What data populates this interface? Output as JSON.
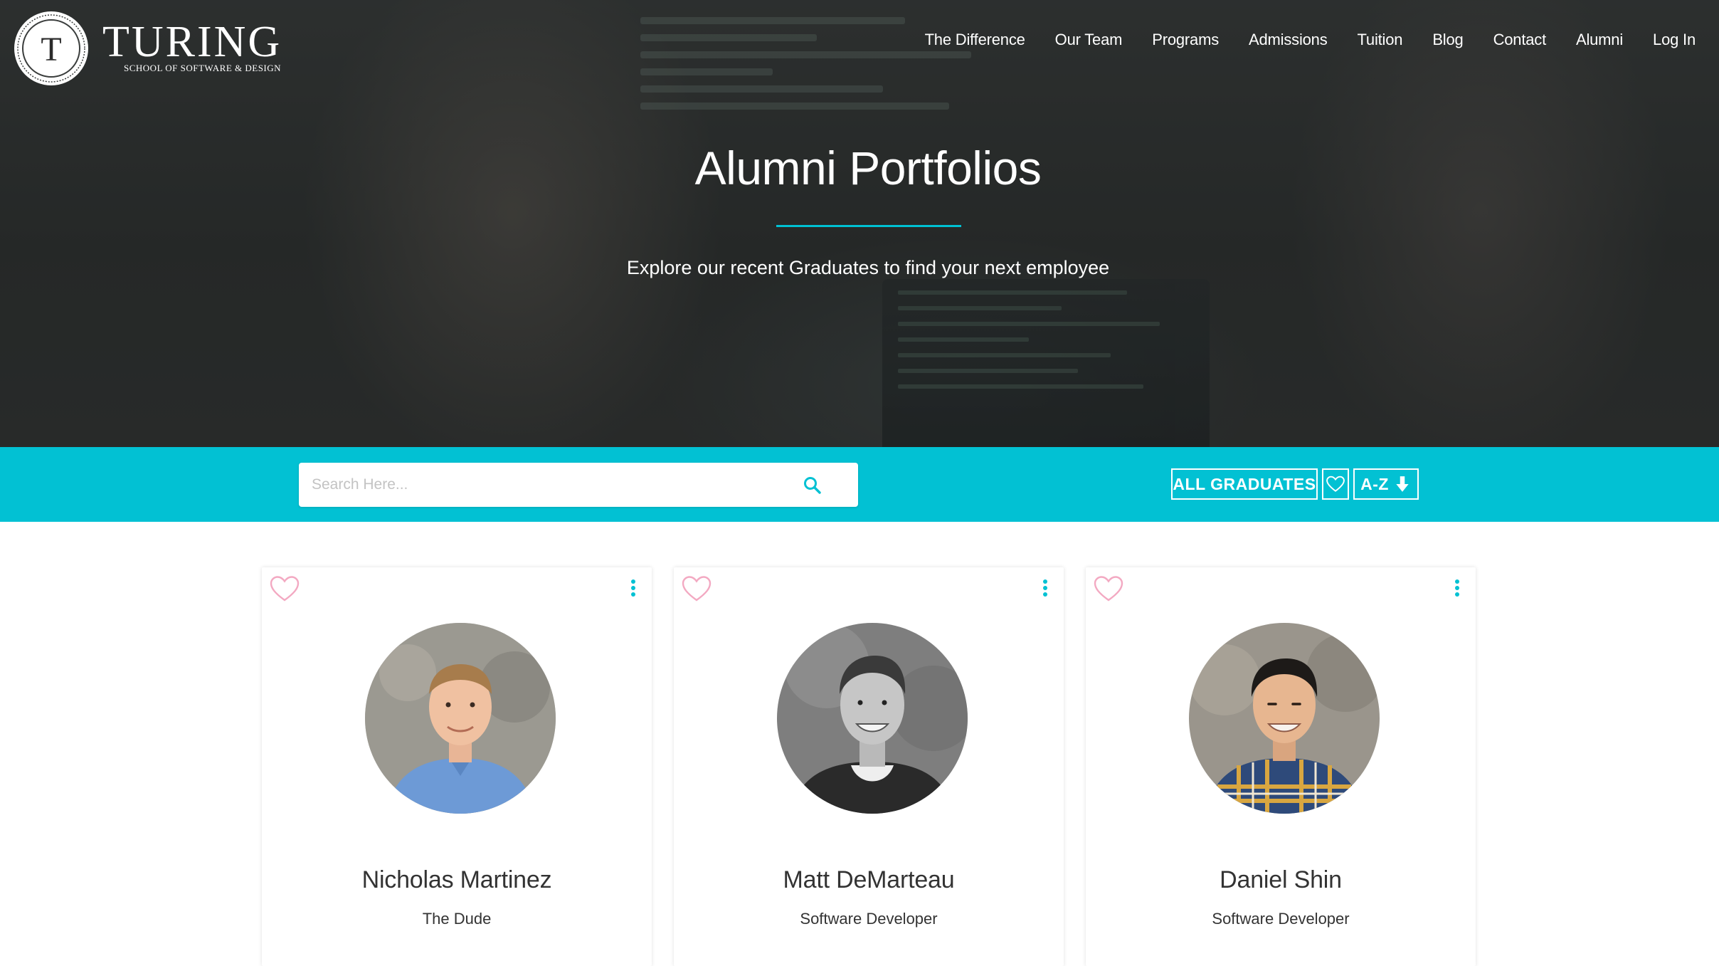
{
  "brand": {
    "name": "TURING",
    "tagline": "SCHOOL OF SOFTWARE & DESIGN",
    "seal_letter": "T"
  },
  "nav": {
    "items": [
      {
        "label": "The Difference"
      },
      {
        "label": "Our Team"
      },
      {
        "label": "Programs"
      },
      {
        "label": "Admissions"
      },
      {
        "label": "Tuition"
      },
      {
        "label": "Blog"
      },
      {
        "label": "Contact"
      },
      {
        "label": "Alumni"
      },
      {
        "label": "Log In"
      }
    ]
  },
  "hero": {
    "title": "Alumni Portfolios",
    "subtitle": "Explore our recent Graduates to find your next employee"
  },
  "filter": {
    "search_placeholder": "Search Here...",
    "search_value": "",
    "all_graduates_label": "ALL GRADUATES",
    "sort_label": "A-Z"
  },
  "cards": [
    {
      "name": "Nicholas Martinez",
      "role": "The Dude",
      "favorited": false
    },
    {
      "name": "Matt DeMarteau",
      "role": "Software Developer",
      "favorited": false
    },
    {
      "name": "Daniel Shin",
      "role": "Software Developer",
      "favorited": false
    }
  ],
  "colors": {
    "accent": "#02c1d3",
    "heart": "#f3a9c2",
    "text": "#333333"
  },
  "icons": {
    "search": "search-icon",
    "heart": "heart-icon",
    "kebab": "kebab-icon",
    "sort": "arrow-down-icon"
  }
}
